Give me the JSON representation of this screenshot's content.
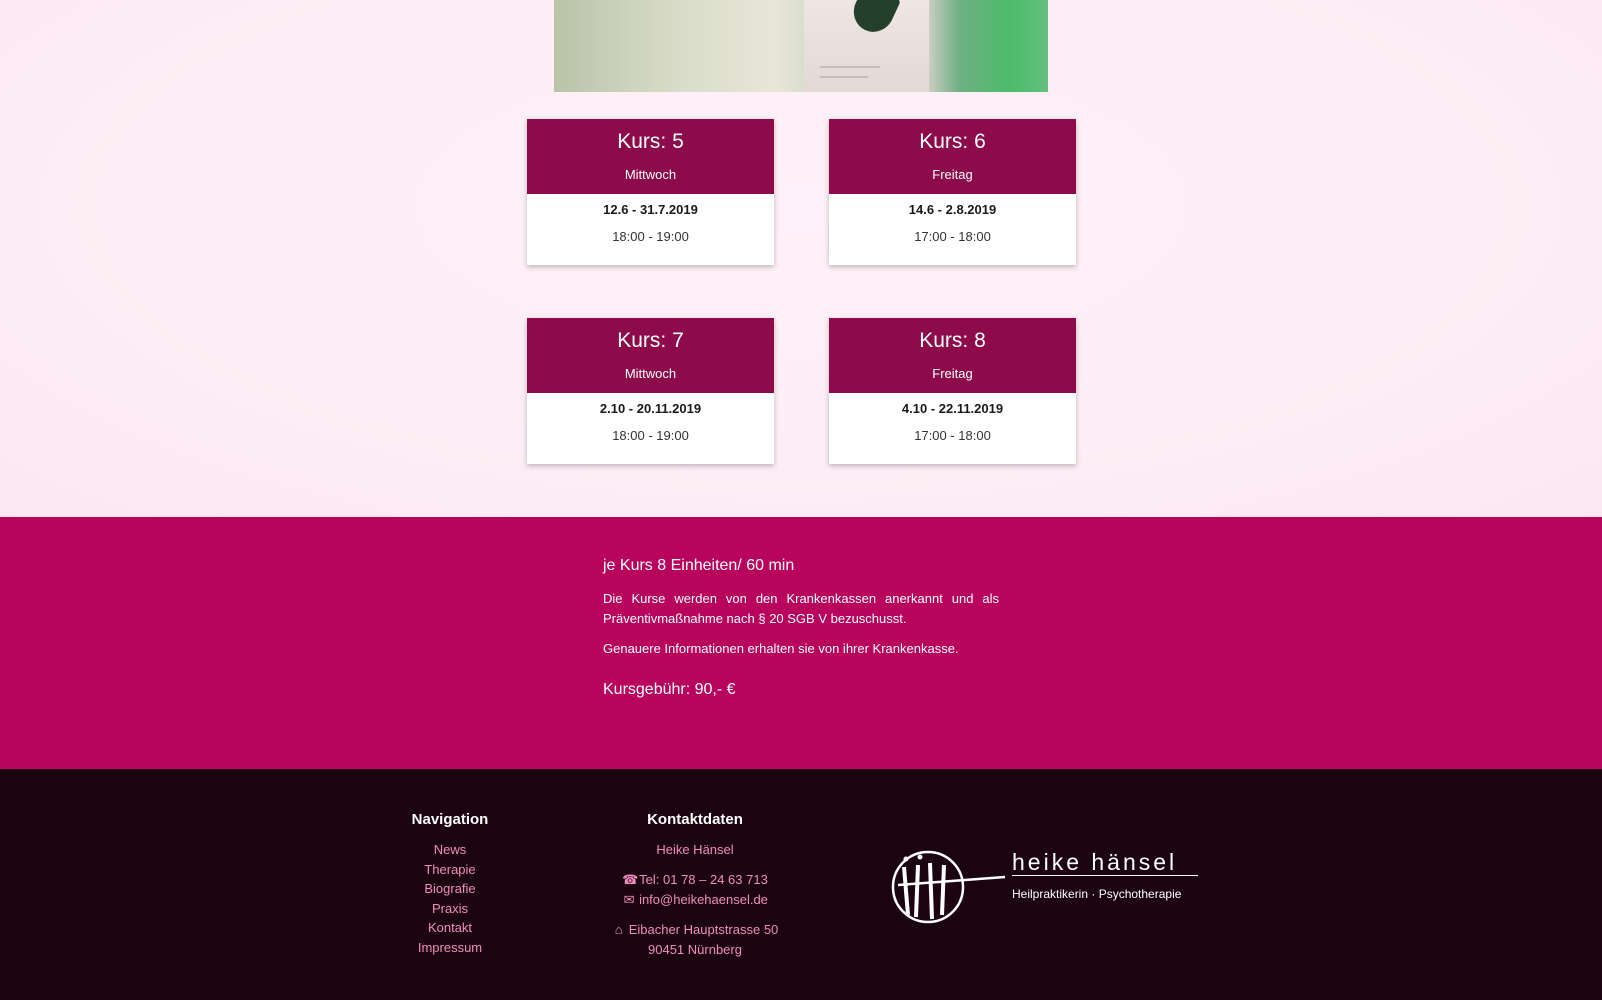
{
  "courses": [
    {
      "title": "Kurs: 5",
      "day": "Mittwoch",
      "dates": "12.6 - 31.7.2019",
      "time": "18:00 - 19:00"
    },
    {
      "title": "Kurs: 6",
      "day": "Freitag",
      "dates": "14.6 - 2.8.2019",
      "time": "17:00 - 18:00"
    },
    {
      "title": "Kurs: 7",
      "day": "Mittwoch",
      "dates": "2.10 - 20.11.2019",
      "time": "18:00 - 19:00"
    },
    {
      "title": "Kurs: 8",
      "day": "Freitag",
      "dates": "4.10 - 22.11.2019",
      "time": "17:00 - 18:00"
    }
  ],
  "info": {
    "title": "je Kurs 8 Einheiten/ 60 min",
    "p1": "Die Kurse werden von den Krankenkassen anerkannt und als Präventivmaßnahme nach § 20 SGB V bezuschusst.",
    "p2": "Genauere Informationen erhalten sie von ihrer Krankenkasse.",
    "fee": "Kursgebühr: 90,- €"
  },
  "footer": {
    "nav_heading": "Navigation",
    "nav_items": [
      "News",
      "Therapie",
      "Biografie",
      "Praxis",
      "Kontakt",
      "Impressum"
    ],
    "contact_heading": "Kontaktdaten",
    "name": "Heike Hänsel",
    "phone": "Tel: 01 78 – 24 63 713",
    "email": "info@heikehaensel.de",
    "street": "Eibacher Hauptstrasse 50",
    "city": "90451 Nürnberg",
    "icons": {
      "phone": "phone-icon",
      "email": "envelope-icon",
      "address": "home-icon"
    }
  },
  "logo": {
    "name": "heike hänsel",
    "subtitle": "Heilpraktikerin · Psychotherapie"
  },
  "colors": {
    "card_header": "#8e0b4b",
    "info_band": "#b8045c",
    "footer_bg": "#1b0410",
    "link": "#f08dbd",
    "page_bg": "#fdeef5"
  }
}
